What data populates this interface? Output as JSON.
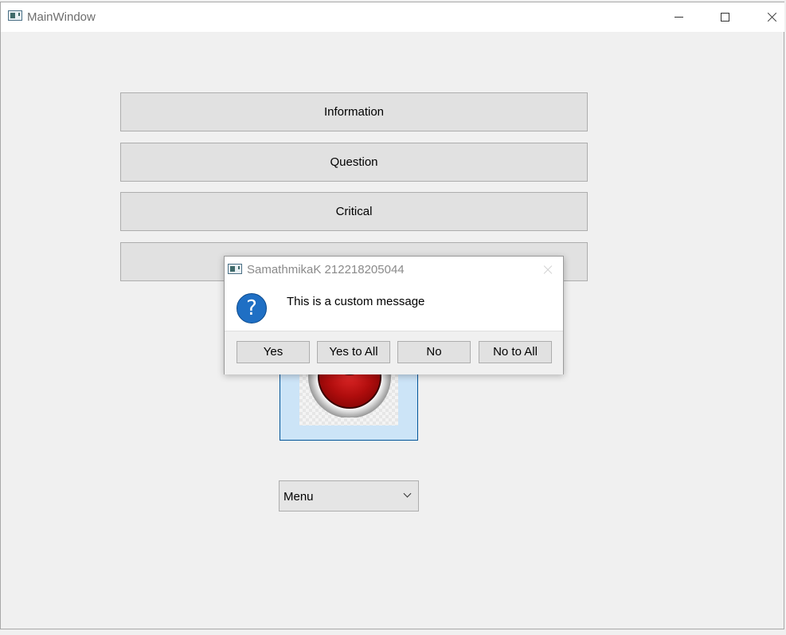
{
  "window": {
    "title": "MainWindow",
    "icon": "app-window-icon",
    "controls": [
      "minimize-icon",
      "maximize-icon",
      "close-icon"
    ]
  },
  "buttons": [
    {
      "label": "Information"
    },
    {
      "label": "Question"
    },
    {
      "label": "Critical"
    },
    {
      "label": ""
    }
  ],
  "image_button": {
    "icon": "red-record-button-icon"
  },
  "combo": {
    "value": "Menu",
    "icon": "chevron-down-icon"
  },
  "dialog": {
    "title": "SamathmikaK 212218205044",
    "message": "This is a custom message",
    "icon_glyph": "?",
    "buttons": [
      {
        "label": "Yes"
      },
      {
        "label": "Yes to All"
      },
      {
        "label": "No"
      },
      {
        "label": "No to All"
      }
    ]
  },
  "colors": {
    "background": "#f0f0f0",
    "accent_blue": "#1f6fc4",
    "selected_button_fill": "#cce4f7"
  }
}
